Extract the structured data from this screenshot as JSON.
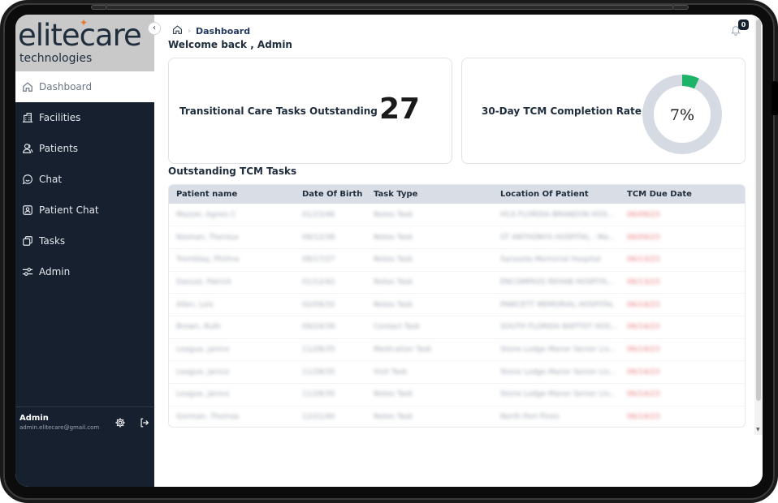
{
  "brand": {
    "logo_text": "elitecare",
    "logo_sub": "technologies"
  },
  "nav": {
    "items": [
      {
        "label": "Dashboard",
        "icon": "home-icon"
      },
      {
        "label": "Facilities",
        "icon": "building-icon"
      },
      {
        "label": "Patients",
        "icon": "users-icon"
      },
      {
        "label": "Chat",
        "icon": "chat-icon"
      },
      {
        "label": "Patient Chat",
        "icon": "patient-chat-icon"
      },
      {
        "label": "Tasks",
        "icon": "tasks-icon"
      },
      {
        "label": "Admin",
        "icon": "admin-icon"
      }
    ]
  },
  "user": {
    "name": "Admin",
    "email": "admin.elitecare@gmail.com"
  },
  "header": {
    "breadcrumb_current": "Dashboard",
    "welcome": "Welcome back , Admin",
    "notification_count": "0"
  },
  "cards": {
    "outstanding": {
      "label": "Transitional Care Tasks Outstanding",
      "value": "27"
    },
    "completion": {
      "label": "30-Day TCM Completion Rate",
      "value": "7%",
      "fraction": 0.07
    }
  },
  "table": {
    "title": "Outstanding TCM Tasks",
    "columns": [
      "Patient name",
      "Date Of Birth",
      "Task Type",
      "Location Of Patient",
      "TCM Due Date"
    ],
    "rows": [
      [
        "Mazzei, Agnes C",
        "01/23/46",
        "Notes Task",
        "HCA FLORIDA BRANDON HOS...",
        "06/09/23"
      ],
      [
        "Nieman, Theresa",
        "09/12/38",
        "Notes Task",
        "ST ANTHONYS HOSPITAL - Ma...",
        "06/09/23"
      ],
      [
        "Tremblay, Philma",
        "08/17/27",
        "Notes Task",
        "Sarasota Memorial Hospital",
        "06/13/23"
      ],
      [
        "Daoust, Patrick",
        "01/12/42",
        "Notes Task",
        "ENCOMPASS REHAB HOSPITA...",
        "06/13/23"
      ],
      [
        "Allen, Lois",
        "02/09/32",
        "Notes Task",
        "PAWCETT MEMORIAL HOSPITAL",
        "06/14/23"
      ],
      [
        "Brown, Ruth",
        "09/24/39",
        "Contact Task",
        "SOUTH FLORIDA BAPTIST HOS...",
        "06/14/23"
      ],
      [
        "League, Janice",
        "11/28/35",
        "Medication Task",
        "Stone Lodge Manor Senior Liv...",
        "06/14/23"
      ],
      [
        "League, Janice",
        "11/28/35",
        "Visit Task",
        "Stone Lodge Manor Senior Liv...",
        "06/14/23"
      ],
      [
        "League, Janice",
        "11/28/35",
        "Notes Task",
        "Stone Lodge Manor Senior Liv...",
        "06/14/23"
      ],
      [
        "Gorman, Thomas",
        "12/21/40",
        "Notes Task",
        "North Port Pines",
        "06/14/23"
      ]
    ]
  },
  "colors": {
    "sidebar": "#16202f",
    "accent_green": "#1db46a",
    "donut_track": "#d6dbe3",
    "due_red": "#e0484d",
    "logo_orange": "#e6762a"
  }
}
